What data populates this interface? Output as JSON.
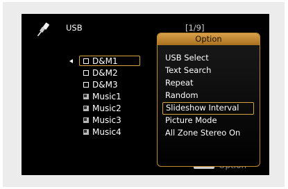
{
  "header": {
    "source_icon": "usb-plug-icon",
    "source_name": "USB",
    "page_indicator": "[1/9]"
  },
  "file_list": {
    "items": [
      {
        "label": "D&M1",
        "kind": "folder",
        "icon": "folder-icon",
        "selected": true
      },
      {
        "label": "D&M2",
        "kind": "folder",
        "icon": "folder-icon"
      },
      {
        "label": "D&M3",
        "kind": "folder",
        "icon": "folder-icon"
      },
      {
        "label": "Music1",
        "kind": "music",
        "icon": "music-file-icon"
      },
      {
        "label": "Music2",
        "kind": "music",
        "icon": "music-file-icon"
      },
      {
        "label": "Music3",
        "kind": "music",
        "icon": "music-file-icon"
      },
      {
        "label": "Music4",
        "kind": "music",
        "icon": "music-file-icon"
      }
    ]
  },
  "option_menu": {
    "title": "Option",
    "items": [
      {
        "label": "USB Select"
      },
      {
        "label": "Text Search"
      },
      {
        "label": "Repeat"
      },
      {
        "label": "Random"
      },
      {
        "label": "Slideshow Interval",
        "selected": true
      },
      {
        "label": "Picture Mode"
      },
      {
        "label": "All Zone Stereo On"
      }
    ]
  },
  "footer_hint": {
    "key_label": "OPTION",
    "text": "Option"
  },
  "colors": {
    "accent": "#d8a33a",
    "background": "#000000",
    "text": "#ffffff"
  }
}
